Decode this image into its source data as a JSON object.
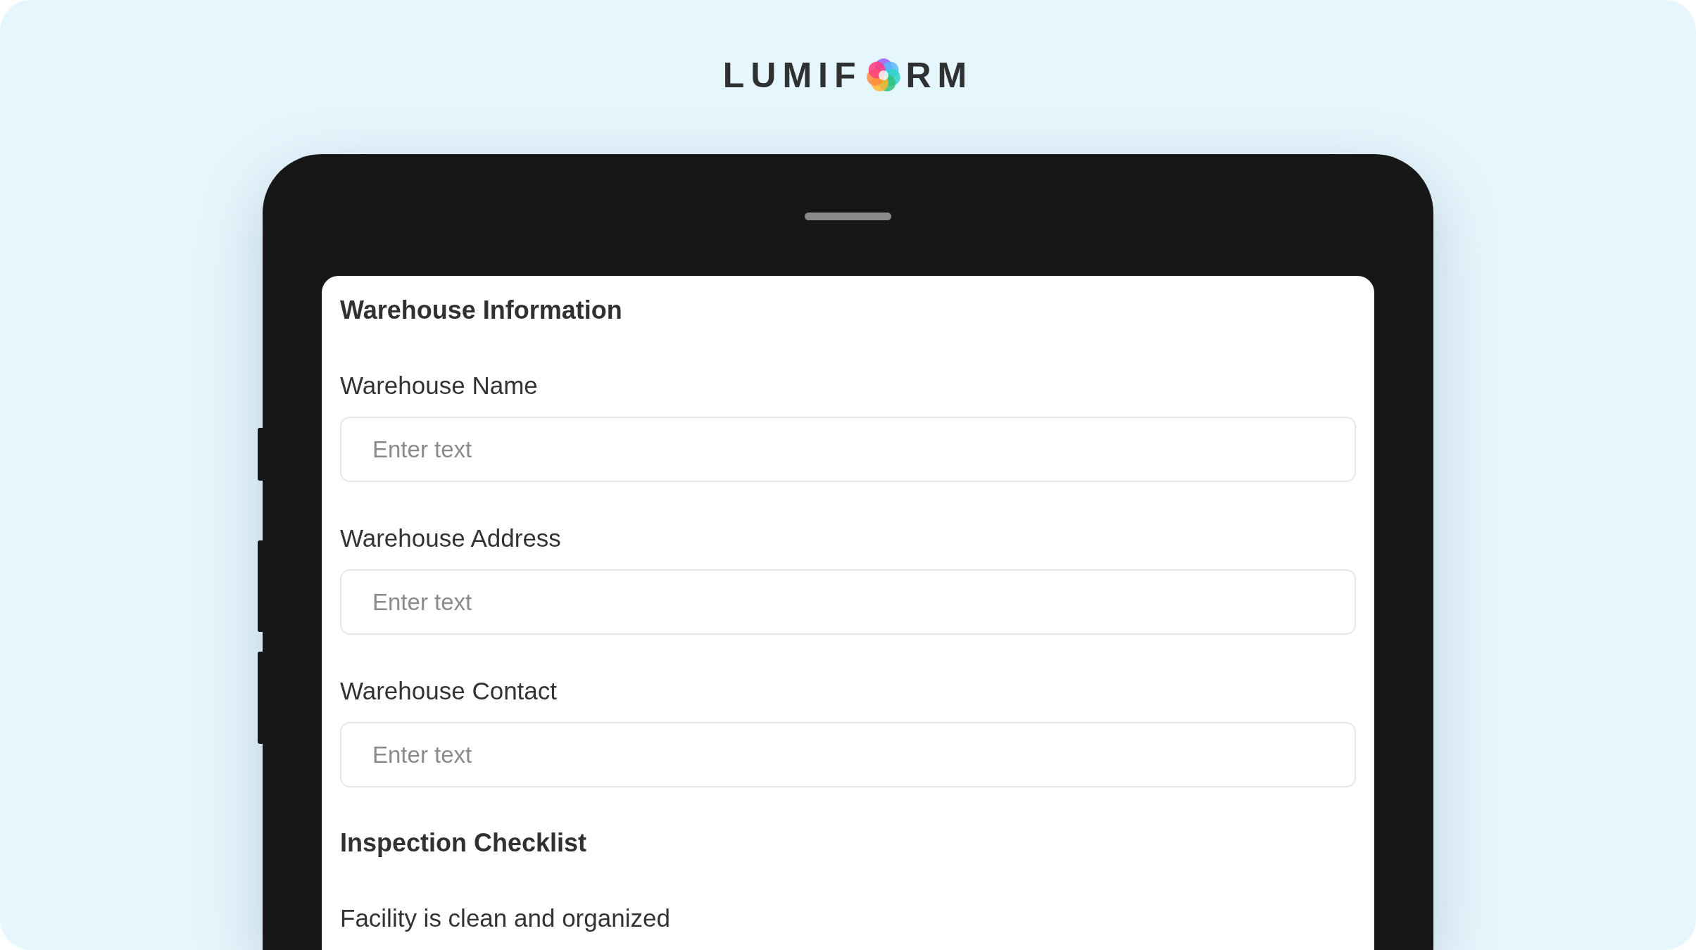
{
  "logo": {
    "before": "LUMIF",
    "after": "RM"
  },
  "form": {
    "sections": [
      {
        "title": "Warehouse Information",
        "items": [
          {
            "kind": "text",
            "label": "Warehouse Name",
            "placeholder": "Enter text"
          },
          {
            "kind": "text",
            "label": "Warehouse Address",
            "placeholder": "Enter text"
          },
          {
            "kind": "text",
            "label": "Warehouse Contact",
            "placeholder": "Enter text"
          }
        ]
      },
      {
        "title": "Inspection Checklist",
        "items": [
          {
            "kind": "question",
            "label": "Facility is clean and organized"
          }
        ]
      }
    ]
  }
}
